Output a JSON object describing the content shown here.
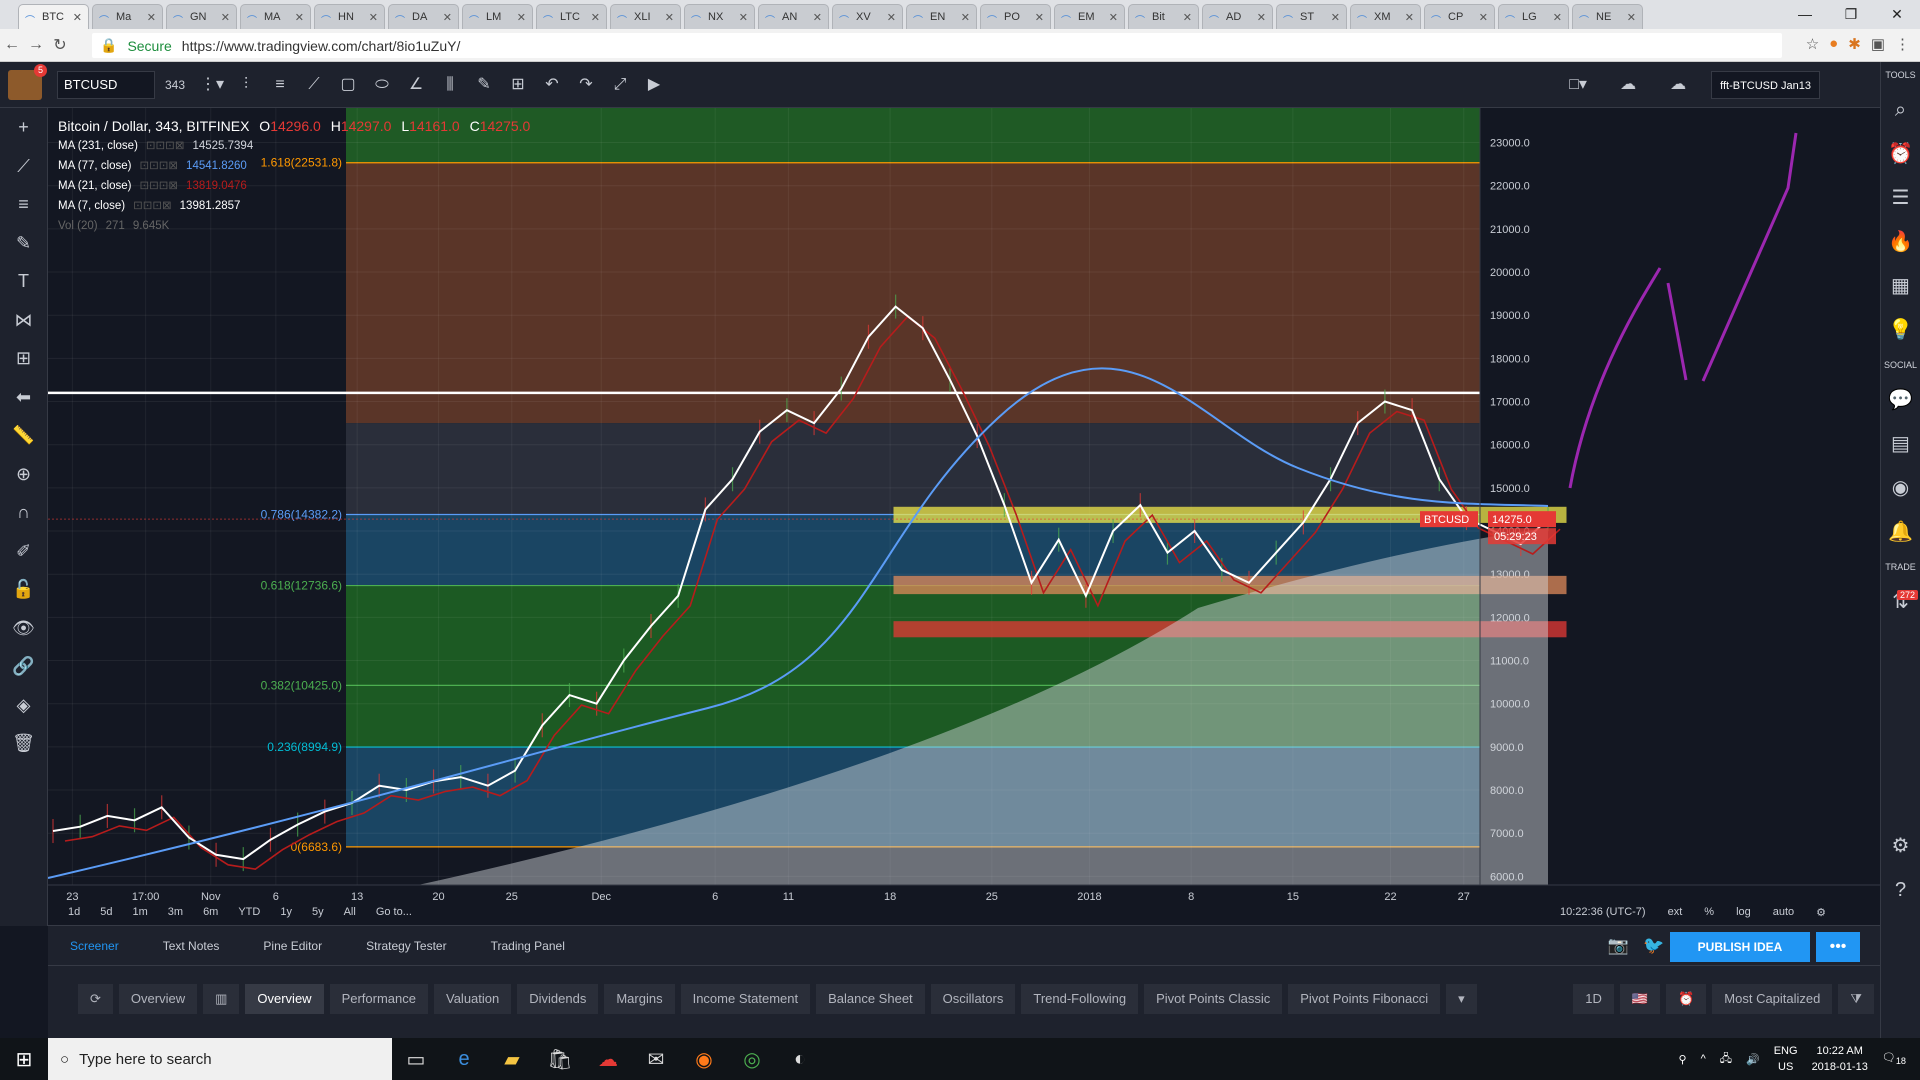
{
  "browser": {
    "tabs": [
      "BTC",
      "Ma",
      "GN",
      "MA",
      "HN",
      "DA",
      "LM",
      "LTC",
      "XLI",
      "NX",
      "AN",
      "XV",
      "EN",
      "PO",
      "EM",
      "Bit",
      "AD",
      "ST",
      "XM",
      "CP",
      "LG",
      "NE"
    ],
    "secure_label": "Secure",
    "url": "https://www.tradingview.com/chart/8io1uZuY/",
    "window_controls": [
      "—",
      "❐",
      "✕"
    ]
  },
  "toolbar": {
    "symbol": "BTCUSD",
    "interval": "343",
    "layout_name": "fft-BTCUSD Jan13"
  },
  "rightbar": {
    "tools_label": "TOOLS",
    "social_label": "SOCIAL",
    "trade_label": "TRADE",
    "badge": "272"
  },
  "legend": {
    "title": "Bitcoin / Dollar, 343, BITFINEX",
    "o_label": "O",
    "o_value": "14296.0",
    "h_label": "H",
    "h_value": "14297.0",
    "l_label": "L",
    "l_value": "14161.0",
    "c_label": "C",
    "c_value": "14275.0",
    "ma": [
      {
        "name": "MA (231, close)",
        "value": "14525.7394",
        "color": "#d1d4dc"
      },
      {
        "name": "MA (77, close)",
        "value": "14541.8260",
        "color": "#5b9cf6"
      },
      {
        "name": "MA (21, close)",
        "value": "13819.0476",
        "color": "#b71c1c"
      },
      {
        "name": "MA (7, close)",
        "value": "13981.2857",
        "color": "#ffffff"
      }
    ],
    "vol": {
      "name": "Vol (20)",
      "v1": "271",
      "v2": "9.645K"
    }
  },
  "fib": [
    {
      "label": "1.618(22531.8)",
      "price": 22531.8,
      "color": "#ff9800"
    },
    {
      "label": "0.786(14382.2)",
      "price": 14382.2,
      "color": "#5b9cf6"
    },
    {
      "label": "0.618(12736.6)",
      "price": 12736.6,
      "color": "#4caf50"
    },
    {
      "label": "0.382(10425.0)",
      "price": 10425.0,
      "color": "#4caf50"
    },
    {
      "label": "0.236(8994.9)",
      "price": 8994.9,
      "color": "#00bcd4"
    },
    {
      "label": "0(6683.6)",
      "price": 6683.6,
      "color": "#ff9800"
    }
  ],
  "chart_data": {
    "type": "line",
    "symbol": "BTCUSD",
    "exchange": "BITFINEX",
    "ylim": [
      5800,
      23800
    ],
    "y_ticks": [
      "23000.0",
      "22000.0",
      "21000.0",
      "20000.0",
      "19000.0",
      "18000.0",
      "17000.0",
      "16000.0",
      "15000.0",
      "14000.0",
      "13000.0",
      "12000.0",
      "11000.0",
      "10000.0",
      "9000.0",
      "8000.0",
      "7000.0",
      "6000.0"
    ],
    "x_ticks": [
      "23",
      "17:00",
      "Nov",
      "6",
      "13",
      "20",
      "25",
      "Dec",
      "6",
      "11",
      "18",
      "25",
      "2018",
      "8",
      "15",
      "22",
      "27"
    ],
    "last_price": "14275.0",
    "countdown": "05:29:23",
    "price_label": "BTCUSD",
    "horizontal_line": 17200,
    "zones": [
      {
        "name": "yellow",
        "low": 14200,
        "high": 14550,
        "color": "#f0e84a"
      },
      {
        "name": "orange",
        "low": 12550,
        "high": 12950,
        "color": "#e08a5a"
      },
      {
        "name": "red",
        "low": 11550,
        "high": 11900,
        "color": "#e53935"
      }
    ],
    "price_series": [
      7050,
      7150,
      7400,
      7300,
      7600,
      6900,
      6500,
      6400,
      6850,
      7200,
      7500,
      7700,
      8100,
      8000,
      8200,
      8300,
      8100,
      8450,
      9500,
      10200,
      10000,
      11000,
      11800,
      12500,
      14500,
      15200,
      16300,
      16800,
      16500,
      17300,
      18500,
      19200,
      18700,
      17500,
      16200,
      14600,
      12800,
      13800,
      12500,
      14000,
      14600,
      13500,
      14000,
      13100,
      12800,
      13500,
      14200,
      15200,
      16500,
      17000,
      16800,
      15200,
      14300,
      14000,
      13700,
      14275
    ]
  },
  "timeframes": [
    "1d",
    "5d",
    "1m",
    "3m",
    "6m",
    "YTD",
    "1y",
    "5y",
    "All",
    "Go to..."
  ],
  "time_info": {
    "clock": "10:22:36 (UTC-7)",
    "ext": "ext",
    "pct": "%",
    "log": "log",
    "auto": "auto"
  },
  "bottom_tabs": [
    "Screener",
    "Text Notes",
    "Pine Editor",
    "Strategy Tester",
    "Trading Panel"
  ],
  "publish_label": "PUBLISH IDEA",
  "screener": {
    "view": "Overview",
    "tabs": [
      "Overview",
      "Performance",
      "Valuation",
      "Dividends",
      "Margins",
      "Income Statement",
      "Balance Sheet",
      "Oscillators",
      "Trend-Following",
      "Pivot Points Classic",
      "Pivot Points Fibonacci"
    ],
    "interval": "1D",
    "sort": "Most Capitalized"
  },
  "taskbar": {
    "search_placeholder": "Type here to search",
    "lang": "ENG",
    "region": "US",
    "time": "10:22 AM",
    "date": "2018-01-13",
    "notif": "18"
  }
}
